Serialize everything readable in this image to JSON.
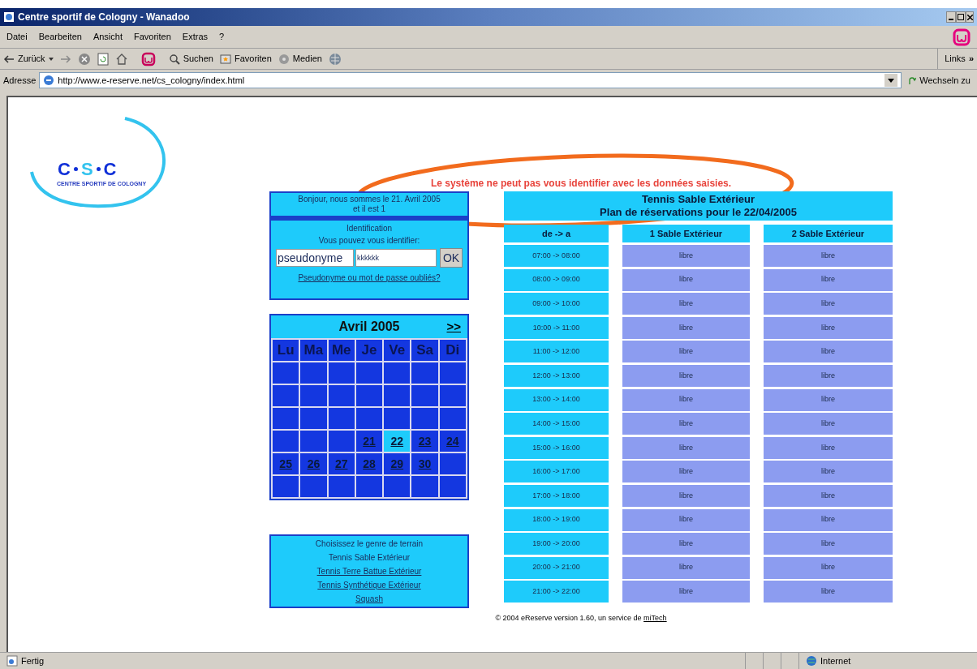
{
  "window": {
    "title": "Centre sportif de Cologny - Wanadoo"
  },
  "menu": [
    "Datei",
    "Bearbeiten",
    "Ansicht",
    "Favoriten",
    "Extras",
    "?"
  ],
  "toolbar": {
    "back": "Zurück",
    "search": "Suchen",
    "favorites": "Favoriten",
    "media": "Medien",
    "links": "Links",
    "links_more": "»"
  },
  "address": {
    "label": "Adresse",
    "url": "http://www.e-reserve.net/cs_cologny/index.html",
    "go": "Wechseln zu"
  },
  "logo": {
    "letters": [
      "C",
      "S",
      "C"
    ],
    "subtitle": "CENTRE SPORTIF DE COLOGNY"
  },
  "error": "Le système ne peut pas vous identifier avec les données saisies.",
  "greeting": [
    "Bonjour, nous sommes le 21. Avril 2005",
    "et il est 1"
  ],
  "login": {
    "title": "Identification",
    "subtitle": "Vous pouvez vous identifier:",
    "username": "pseudonyme",
    "password": "kkkkkk",
    "ok": "OK",
    "forgot": "Pseudonyme ou mot de passe oubliés?"
  },
  "calendar": {
    "title": "Avril 2005",
    "next": ">>",
    "weekdays": [
      "Lu",
      "Ma",
      "Me",
      "Je",
      "Ve",
      "Sa",
      "Di"
    ],
    "weeks": [
      {
        "days": [
          {
            "selected": false
          },
          {
            "selected": false
          },
          {
            "selected": false
          },
          {
            "selected": false
          },
          {
            "selected": false
          },
          {
            "selected": false
          },
          {
            "selected": false
          }
        ]
      },
      {
        "days": [
          {
            "selected": false
          },
          {
            "selected": false
          },
          {
            "selected": false
          },
          {
            "selected": false
          },
          {
            "selected": false
          },
          {
            "selected": false
          },
          {
            "selected": false
          }
        ]
      },
      {
        "days": [
          {
            "selected": false
          },
          {
            "selected": false
          },
          {
            "selected": false
          },
          {
            "selected": false
          },
          {
            "selected": false
          },
          {
            "selected": false
          },
          {
            "selected": false
          }
        ]
      },
      {
        "days": [
          {
            "selected": false
          },
          {
            "selected": false
          },
          {
            "selected": false
          },
          {
            "label": "21",
            "selected": false
          },
          {
            "label": "22",
            "selected": true
          },
          {
            "label": "23",
            "selected": false
          },
          {
            "label": "24",
            "selected": false
          }
        ]
      },
      {
        "days": [
          {
            "label": "25",
            "selected": false
          },
          {
            "label": "26",
            "selected": false
          },
          {
            "label": "27",
            "selected": false
          },
          {
            "label": "28",
            "selected": false
          },
          {
            "label": "29",
            "selected": false
          },
          {
            "label": "30",
            "selected": false
          },
          {
            "selected": false
          }
        ]
      },
      {
        "days": [
          {
            "selected": false
          },
          {
            "selected": false
          },
          {
            "selected": false
          },
          {
            "selected": false
          },
          {
            "selected": false
          },
          {
            "selected": false
          },
          {
            "selected": false
          }
        ]
      }
    ]
  },
  "terrain": {
    "title": "Choisissez le genre de terrain",
    "options": [
      {
        "label": "Tennis Sable Extérieur",
        "selected": true
      },
      {
        "label": "Tennis Terre Battue Extérieur",
        "selected": false
      },
      {
        "label": "Tennis Synthétique Extérieur",
        "selected": false
      },
      {
        "label": "Squash",
        "selected": false
      }
    ]
  },
  "schedule": {
    "title": [
      "Tennis Sable Extérieur",
      "Plan de réservations pour le 22/04/2005"
    ],
    "columns": [
      "de -> a",
      "1 Sable Extérieur",
      "2 Sable Extérieur"
    ],
    "rows": [
      {
        "cells": [
          "07:00 -> 08:00",
          "libre",
          "libre"
        ]
      },
      {
        "cells": [
          "08:00 -> 09:00",
          "libre",
          "libre"
        ]
      },
      {
        "cells": [
          "09:00 -> 10:00",
          "libre",
          "libre"
        ]
      },
      {
        "cells": [
          "10:00 -> 11:00",
          "libre",
          "libre"
        ]
      },
      {
        "cells": [
          "11:00 -> 12:00",
          "libre",
          "libre"
        ]
      },
      {
        "cells": [
          "12:00 -> 13:00",
          "libre",
          "libre"
        ]
      },
      {
        "cells": [
          "13:00 -> 14:00",
          "libre",
          "libre"
        ]
      },
      {
        "cells": [
          "14:00 -> 15:00",
          "libre",
          "libre"
        ]
      },
      {
        "cells": [
          "15:00 -> 16:00",
          "libre",
          "libre"
        ]
      },
      {
        "cells": [
          "16:00 -> 17:00",
          "libre",
          "libre"
        ]
      },
      {
        "cells": [
          "17:00 -> 18:00",
          "libre",
          "libre"
        ]
      },
      {
        "cells": [
          "18:00 -> 19:00",
          "libre",
          "libre"
        ]
      },
      {
        "cells": [
          "19:00 -> 20:00",
          "libre",
          "libre"
        ]
      },
      {
        "cells": [
          "20:00 -> 21:00",
          "libre",
          "libre"
        ]
      },
      {
        "cells": [
          "21:00 -> 22:00",
          "libre",
          "libre"
        ]
      }
    ]
  },
  "footer": {
    "text": "© 2004 eReserve version 1.60, un service de ",
    "link": "miTech"
  },
  "status_bar": {
    "text": "Fertig",
    "zone": "Internet"
  }
}
